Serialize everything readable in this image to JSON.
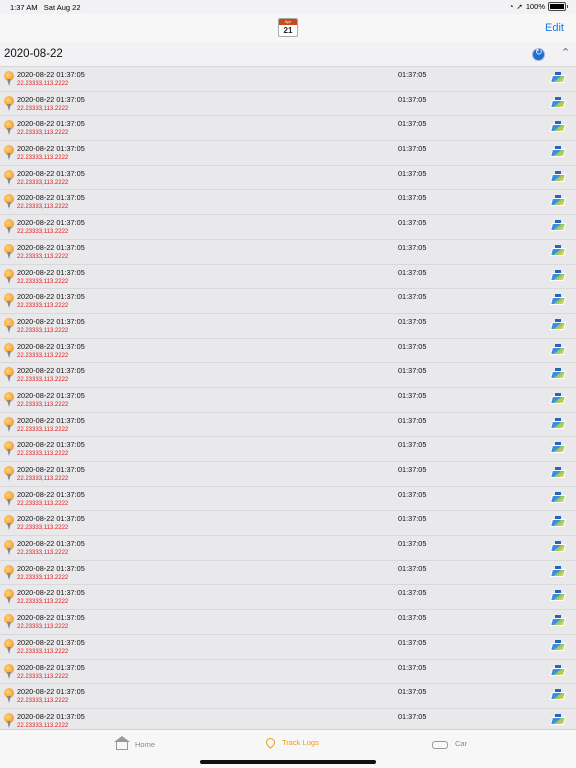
{
  "status_bar": {
    "time": "1:37 AM",
    "date": "Sat Aug 22",
    "battery": "100%",
    "battery_level": 1.0
  },
  "nav": {
    "calendar_month": "Apr",
    "calendar_day": "21",
    "edit_label": "Edit"
  },
  "section": {
    "title": "2020-08-22"
  },
  "rows": [
    {
      "datetime": "2020-08-22 01:37:05",
      "coords": "22.23333,113.2222",
      "duration": "01:37:05"
    },
    {
      "datetime": "2020-08-22 01:37:05",
      "coords": "22.23333,113.2222",
      "duration": "01:37:05"
    },
    {
      "datetime": "2020-08-22 01:37:05",
      "coords": "22.23333,113.2222",
      "duration": "01:37:05"
    },
    {
      "datetime": "2020-08-22 01:37:05",
      "coords": "22.23333,113.2222",
      "duration": "01:37:05"
    },
    {
      "datetime": "2020-08-22 01:37:05",
      "coords": "22.23333,113.2222",
      "duration": "01:37:05"
    },
    {
      "datetime": "2020-08-22 01:37:05",
      "coords": "22.23333,113.2222",
      "duration": "01:37:05"
    },
    {
      "datetime": "2020-08-22 01:37:05",
      "coords": "22.23333,113.2222",
      "duration": "01:37:05"
    },
    {
      "datetime": "2020-08-22 01:37:05",
      "coords": "22.23333,113.2222",
      "duration": "01:37:05"
    },
    {
      "datetime": "2020-08-22 01:37:05",
      "coords": "22.23333,113.2222",
      "duration": "01:37:05"
    },
    {
      "datetime": "2020-08-22 01:37:05",
      "coords": "22.23333,113.2222",
      "duration": "01:37:05"
    },
    {
      "datetime": "2020-08-22 01:37:05",
      "coords": "22.23333,113.2222",
      "duration": "01:37:05"
    },
    {
      "datetime": "2020-08-22 01:37:05",
      "coords": "22.23333,113.2222",
      "duration": "01:37:05"
    },
    {
      "datetime": "2020-08-22 01:37:05",
      "coords": "22.23333,113.2222",
      "duration": "01:37:05"
    },
    {
      "datetime": "2020-08-22 01:37:05",
      "coords": "22.23333,113.2222",
      "duration": "01:37:05"
    },
    {
      "datetime": "2020-08-22 01:37:05",
      "coords": "22.23333,113.2222",
      "duration": "01:37:05"
    },
    {
      "datetime": "2020-08-22 01:37:05",
      "coords": "22.23333,113.2222",
      "duration": "01:37:05"
    },
    {
      "datetime": "2020-08-22 01:37:05",
      "coords": "22.23333,113.2222",
      "duration": "01:37:05"
    },
    {
      "datetime": "2020-08-22 01:37:05",
      "coords": "22.23333,113.2222",
      "duration": "01:37:05"
    },
    {
      "datetime": "2020-08-22 01:37:05",
      "coords": "22.23333,113.2222",
      "duration": "01:37:05"
    },
    {
      "datetime": "2020-08-22 01:37:05",
      "coords": "22.23333,113.2222",
      "duration": "01:37:05"
    },
    {
      "datetime": "2020-08-22 01:37:05",
      "coords": "22.23333,113.2222",
      "duration": "01:37:05"
    },
    {
      "datetime": "2020-08-22 01:37:05",
      "coords": "22.23333,113.2222",
      "duration": "01:37:05"
    },
    {
      "datetime": "2020-08-22 01:37:05",
      "coords": "22.23333,113.2222",
      "duration": "01:37:05"
    },
    {
      "datetime": "2020-08-22 01:37:05",
      "coords": "22.23333,113.2222",
      "duration": "01:37:05"
    },
    {
      "datetime": "2020-08-22 01:37:05",
      "coords": "22.23333,113.2222",
      "duration": "01:37:05"
    },
    {
      "datetime": "2020-08-22 01:37:05",
      "coords": "22.23333,113.2222",
      "duration": "01:37:05"
    },
    {
      "datetime": "2020-08-22 01:37:05",
      "coords": "22.23333,113.2222",
      "duration": "01:37:05"
    }
  ],
  "tabs": [
    {
      "label": "Home",
      "icon": "home-icon",
      "active": false
    },
    {
      "label": "Track Logs",
      "icon": "map-pin-icon",
      "active": true
    },
    {
      "label": "Car",
      "icon": "car-icon",
      "active": false
    }
  ],
  "colors": {
    "accent": "#1a7ae0",
    "active_tab": "#f09a15",
    "coords": "#e01a1a"
  }
}
